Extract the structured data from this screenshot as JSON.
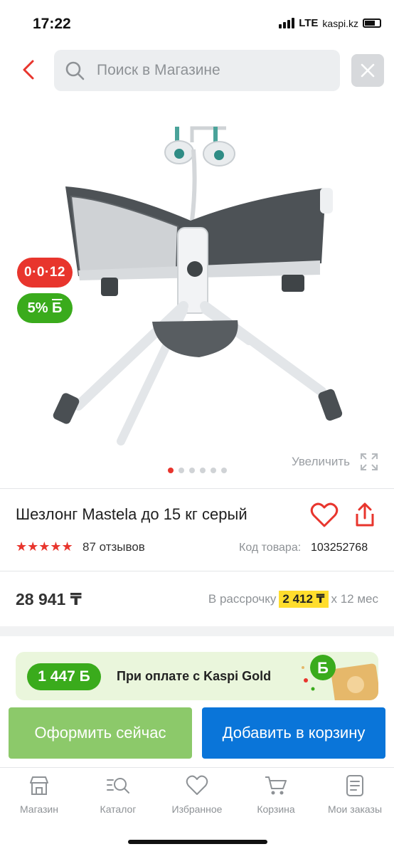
{
  "status_bar": {
    "time": "17:22",
    "network": "LTE",
    "url_fragment": "kaspi.kz"
  },
  "header": {
    "search_placeholder": "Поиск в Магазине"
  },
  "badges": {
    "installment": "0·0·12",
    "bonus": "5%",
    "bonus_currency": "Б"
  },
  "gallery": {
    "zoom_label": "Увеличить",
    "dots": 6,
    "active_dot": 0
  },
  "product": {
    "title": "Шезлонг Mastela до 15 кг серый",
    "rating": 5,
    "stars": "★★★★★",
    "reviews": "87 отзывов",
    "sku_label": "Код товара:",
    "sku_value": "103252768",
    "price": "28 941 ₸",
    "installment_prefix": "В рассрочку",
    "installment_amount": "2 412 ₸",
    "installment_suffix": "x 12 мес"
  },
  "gold_banner": {
    "bonus": "1 447 Б",
    "text": "При оплате с Kaspi Gold"
  },
  "actions": {
    "checkout": "Оформить сейчас",
    "add_to_cart": "Добавить в корзину"
  },
  "nav": [
    {
      "label": "Магазин",
      "icon": "store-icon"
    },
    {
      "label": "Каталог",
      "icon": "catalog-search-icon"
    },
    {
      "label": "Избранное",
      "icon": "heart-icon"
    },
    {
      "label": "Корзина",
      "icon": "cart-icon"
    },
    {
      "label": "Мои заказы",
      "icon": "orders-icon"
    }
  ],
  "colors": {
    "accent_red": "#e8352d",
    "bonus_green": "#3aab1c",
    "cart_blue": "#0a75d9",
    "checkout_green": "#8cc96a",
    "installment_yellow": "#ffdd2d"
  }
}
